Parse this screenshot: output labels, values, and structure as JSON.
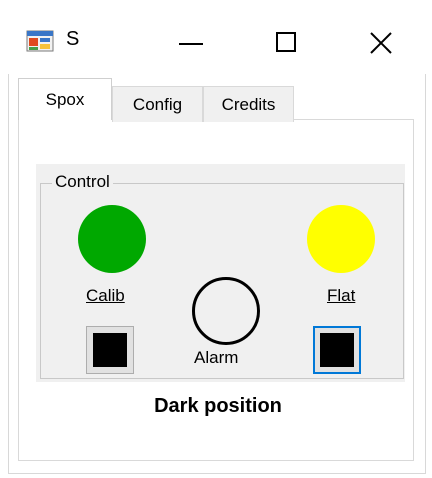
{
  "window": {
    "title": "S",
    "icon": "app-icon",
    "controls": {
      "minimize": "minimize-icon",
      "maximize": "maximize-icon",
      "close": "close-icon"
    }
  },
  "tabs": [
    {
      "label": "Spox",
      "selected": true
    },
    {
      "label": "Config",
      "selected": false
    },
    {
      "label": "Credits",
      "selected": false
    }
  ],
  "control_group": {
    "legend": "Control",
    "calib": {
      "label": "Calib",
      "led_color": "#00a800"
    },
    "flat": {
      "label": "Flat",
      "led_color": "#ffff00"
    },
    "alarm": {
      "label": "Alarm"
    }
  },
  "status_text": "Dark position"
}
